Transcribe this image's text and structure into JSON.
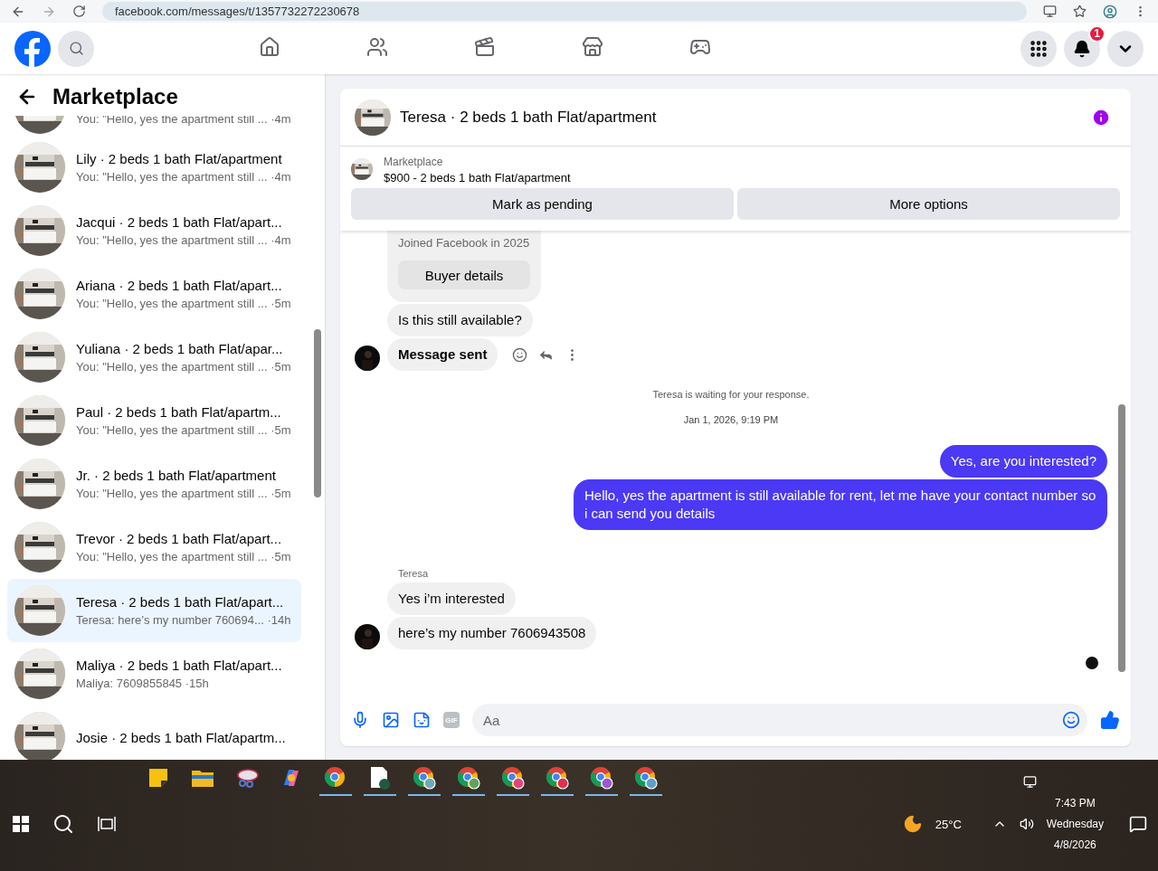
{
  "browser": {
    "url": "facebook.com/messages/t/1357732272230678"
  },
  "topnav": {
    "notification_count": "1",
    "tabs": [
      {
        "kind": "home",
        "selected": false
      },
      {
        "kind": "friends",
        "selected": false
      },
      {
        "kind": "video",
        "selected": false
      },
      {
        "kind": "marketplace",
        "selected": false
      },
      {
        "kind": "gaming",
        "selected": false
      }
    ]
  },
  "sidebar": {
    "title": "Marketplace",
    "items": [
      {
        "subtitle": "You: \"Hello, yes the apartment still ...",
        "time": "·4m",
        "selected": false
      },
      {
        "title": "Lily · 2 beds 1 bath Flat/apartment",
        "subtitle": "You: \"Hello, yes the apartment still ...",
        "time": "·4m",
        "selected": false
      },
      {
        "title": "Jacqui · 2 beds 1 bath Flat/apart...",
        "subtitle": "You: \"Hello, yes the apartment still ...",
        "time": "·4m",
        "selected": false
      },
      {
        "title": "Ariana · 2 beds 1 bath Flat/apart...",
        "subtitle": "You: \"Hello, yes the apartment still ...",
        "time": "·5m",
        "selected": false
      },
      {
        "title": "Yuliana · 2 beds 1 bath Flat/apar...",
        "subtitle": "You: \"Hello, yes the apartment still ...",
        "time": "·5m",
        "selected": false
      },
      {
        "title": "Paul · 2 beds 1 bath Flat/apartm...",
        "subtitle": "You: \"Hello, yes the apartment still ...",
        "time": "·5m",
        "selected": false
      },
      {
        "title": "Jr. · 2 beds 1 bath Flat/apartment",
        "subtitle": "You: \"Hello, yes the apartment still ...",
        "time": "·5m",
        "selected": false
      },
      {
        "title": "Trevor · 2 beds 1 bath Flat/apart...",
        "subtitle": "You: \"Hello, yes the apartment still ...",
        "time": "·5m",
        "selected": false
      },
      {
        "title": "Teresa · 2 beds 1 bath Flat/apart...",
        "subtitle": "Teresa: here’s my number 760694...",
        "time": "·14h",
        "selected": true
      },
      {
        "title": "Maliya · 2 beds 1 bath Flat/apart...",
        "subtitle": "Maliya: 7609855845",
        "time": "·15h",
        "selected": false
      },
      {
        "title": "Josie · 2 beds 1 bath Flat/apartm...",
        "selected": false
      }
    ]
  },
  "chat": {
    "title": "Teresa · 2 beds 1 bath Flat/apartment",
    "listing": {
      "source": "Marketplace",
      "title": "$900 - 2 beds 1 bath Flat/apartment",
      "buttons": [
        "Mark as pending",
        "More options"
      ]
    },
    "messages": [
      {
        "kind": "profile",
        "text": "Joined Facebook in 2025",
        "button": "Buyer details"
      },
      {
        "kind": "incoming",
        "text": "Is this still available?"
      },
      {
        "kind": "incoming",
        "text": "Message sent",
        "bold": true,
        "avatar": true,
        "actions": true
      },
      {
        "kind": "system",
        "text": "Teresa is waiting for your response."
      },
      {
        "kind": "timestamp",
        "text": "Jan 1, 2026, 9:19 PM"
      },
      {
        "kind": "outgoing",
        "text": "Yes, are you interested?"
      },
      {
        "kind": "outgoing",
        "text": "Hello, yes the apartment is still available for rent, let me have your contact number so i can send you details"
      },
      {
        "kind": "sender",
        "text": "Teresa"
      },
      {
        "kind": "incoming",
        "text": "Yes i’m interested"
      },
      {
        "kind": "incoming",
        "text": "here’s my number 7606943508",
        "avatar": true
      },
      {
        "kind": "seen"
      }
    ],
    "composer": {
      "gif_label": "GIF",
      "placeholder": "Aa"
    }
  },
  "taskbar": {
    "apps": [
      {
        "kind": "notes",
        "running": false
      },
      {
        "kind": "folder",
        "running": false
      },
      {
        "kind": "snip",
        "running": false
      },
      {
        "kind": "copilot",
        "running": false
      },
      {
        "kind": "chrome",
        "running": true
      },
      {
        "kind": "doc",
        "running": true,
        "color": "#1e5b3c"
      },
      {
        "kind": "chrome",
        "running": true,
        "color": "#6fa8b8"
      },
      {
        "kind": "chrome",
        "running": true,
        "color": "#5ea35e"
      },
      {
        "kind": "chrome",
        "running": true,
        "color": "#e0457b"
      },
      {
        "kind": "chrome",
        "running": true,
        "color": "#e03050"
      },
      {
        "kind": "chrome",
        "running": true,
        "color": "#9b59d0"
      },
      {
        "kind": "chrome",
        "running": true,
        "color": "#5aa0c8"
      }
    ],
    "weather": "25°C",
    "time": "7:43 PM",
    "day": "Wednesday",
    "date": "4/8/2026"
  }
}
